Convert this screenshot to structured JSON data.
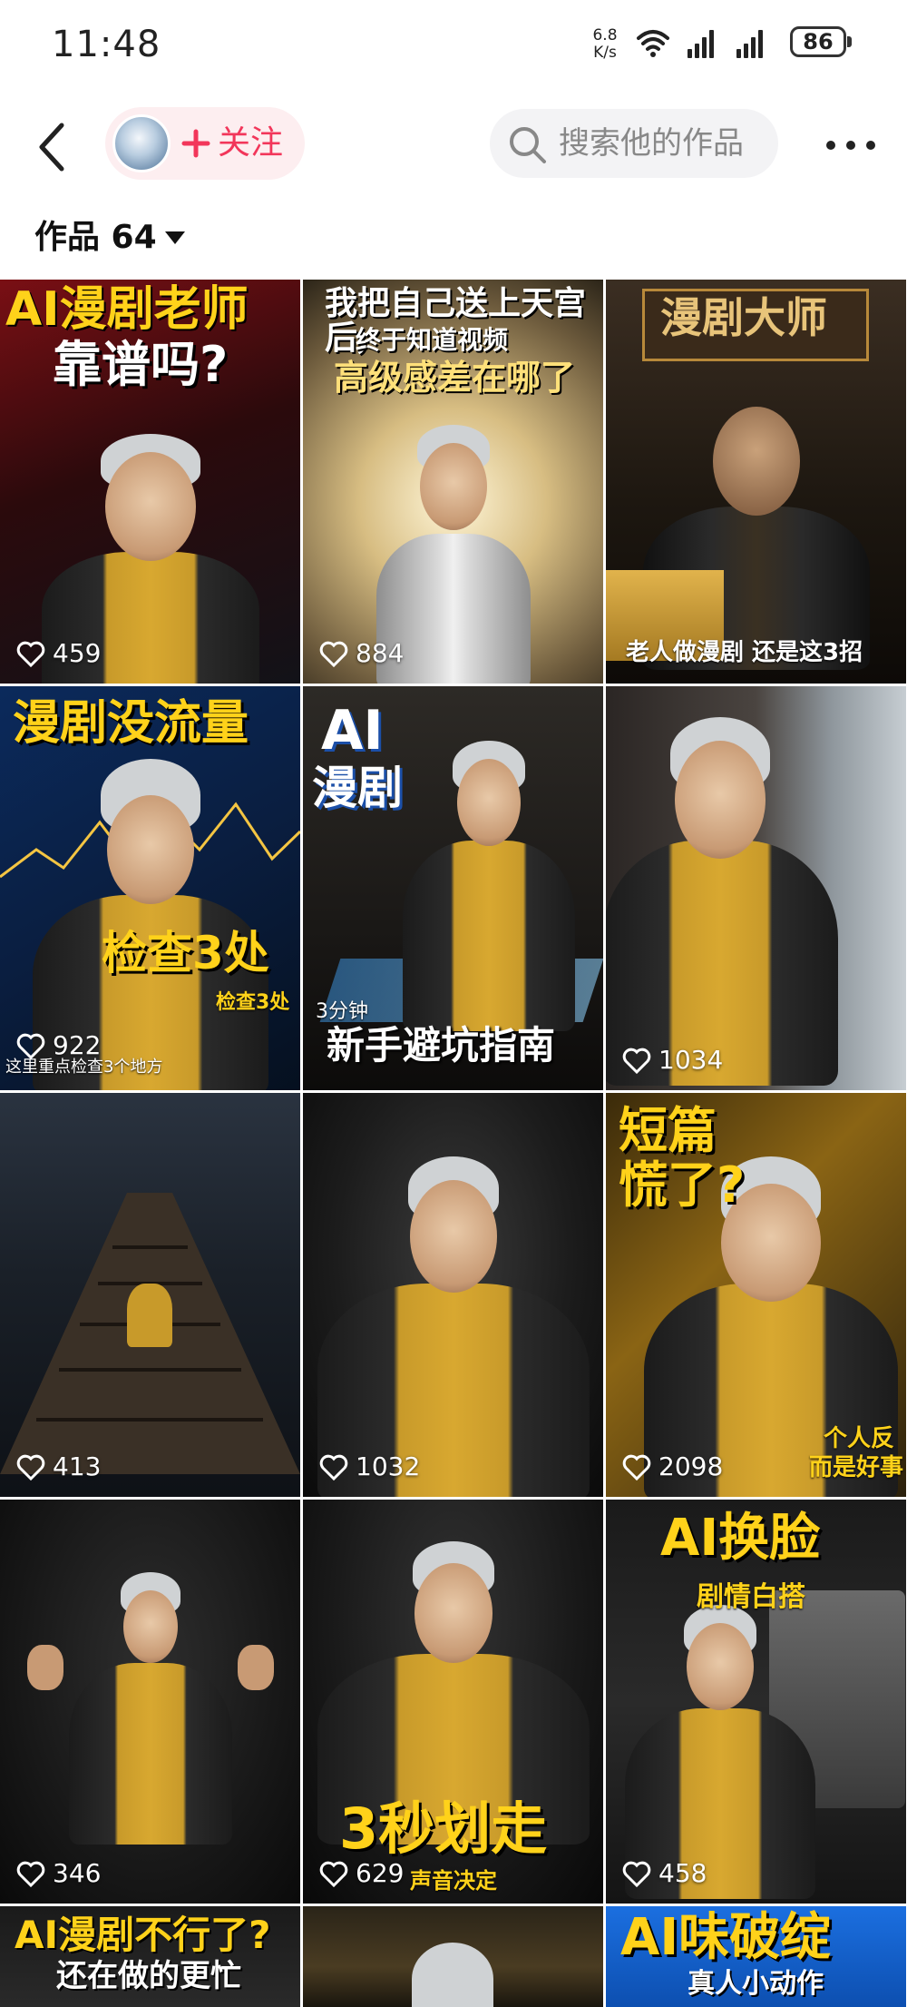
{
  "status_bar": {
    "time": "11:48",
    "net_speed_value": "6.8",
    "net_speed_unit": "K/s",
    "wifi_icon": "wifi-icon",
    "battery": "86"
  },
  "top_bar": {
    "follow_label": "关注",
    "search_placeholder": "搜索他的作品"
  },
  "works": {
    "label": "作品 64"
  },
  "tiles": [
    {
      "likes": "459",
      "title": "AI漫剧老师",
      "title2": "靠谱吗?"
    },
    {
      "likes": "884",
      "title": "我把自己送上天宫后,",
      "title2": "终于知道视频",
      "title3": "高级感差在哪了"
    },
    {
      "likes": "",
      "title": "漫剧大师",
      "overlay": "老人做漫剧 还是这3招"
    },
    {
      "likes": "922",
      "title": "漫剧没流量",
      "title2": "检查3处",
      "sub": "检查3处",
      "overlay": "这里重点检查3个地方"
    },
    {
      "likes": "",
      "title": "AI",
      "title2": "漫剧",
      "sub": "3分钟",
      "overlay": "新手避坑指南"
    },
    {
      "likes": "1034"
    },
    {
      "likes": "413"
    },
    {
      "likes": "1032"
    },
    {
      "likes": "2098",
      "title": "短篇",
      "title2": "慌了?",
      "sub": "个人反",
      "sub2": "而是好事"
    },
    {
      "likes": "346"
    },
    {
      "likes": "629",
      "title": "3秒划走",
      "sub": "声音决定"
    },
    {
      "likes": "458",
      "title": "AI换脸",
      "sub": "剧情白搭"
    },
    {
      "likes": "",
      "title": "AI漫剧不行了?",
      "title2": "还在做的更忙"
    },
    {
      "likes": ""
    },
    {
      "likes": "",
      "title": "AI味破绽",
      "title2": "真人小动作"
    }
  ]
}
